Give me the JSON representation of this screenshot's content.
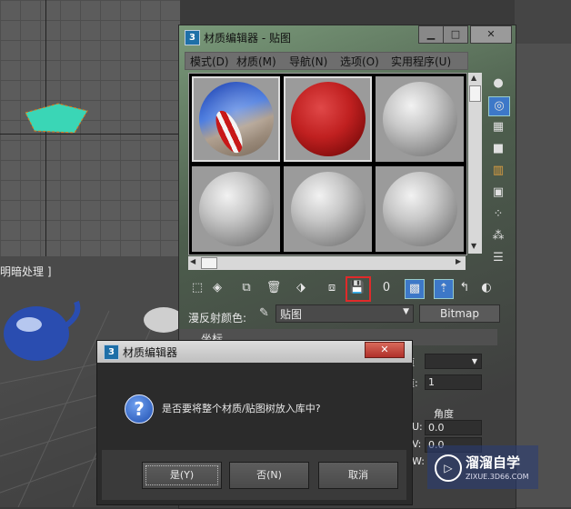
{
  "viewport": {
    "persp_label": "明暗处理 ]"
  },
  "material_editor": {
    "title": "材质编辑器 - 贴图",
    "app_icon": "3",
    "window_controls": [
      "minimize-icon",
      "maximize-icon",
      "close-icon"
    ],
    "close_glyph": "✕",
    "menu": [
      "模式(D)",
      "材质(M)",
      "导航(N)",
      "选项(O)",
      "实用程序(U)"
    ],
    "slots": [
      {
        "kind": "beach-ball",
        "active": true
      },
      {
        "kind": "red",
        "active": true
      },
      {
        "kind": "grey",
        "active": false
      },
      {
        "kind": "grey",
        "active": false
      },
      {
        "kind": "grey",
        "active": false
      },
      {
        "kind": "grey",
        "active": false
      }
    ],
    "side_tools": [
      "sample-type-icon",
      "backlight-icon",
      "background-icon",
      "sample-uv-icon",
      "video-color-icon",
      "make-preview-icon",
      "options-icon",
      "select-by-material-icon",
      "material-navigator-icon"
    ],
    "bottom_tools": [
      "get-material-icon",
      "put-to-scene-icon",
      "assign-to-selection-icon",
      "reset-map-icon",
      "make-copy-icon",
      "make-unique-icon",
      "put-to-library-icon",
      "material-id-icon",
      "show-in-viewport-icon",
      "show-end-result-icon",
      "go-to-parent-icon",
      "go-forward-icon"
    ],
    "highlighted_tool": "put-to-library-icon",
    "diffuse_label": "漫反射颜色:",
    "map_name": "贴图",
    "map_type_button": "Bitmap",
    "coord_rollout_title": "坐标",
    "params": {
      "channel_fragment": "道",
      "map_channel_label": "道:",
      "map_channel_value": "1",
      "angle_header": "角度",
      "u_label": "U:",
      "u_value": "0.0",
      "v_label": "V:",
      "v_value": "0.0",
      "w_label": "W:"
    }
  },
  "dialog": {
    "title": "材质编辑器",
    "app_icon": "3",
    "close_glyph": "✕",
    "question_glyph": "?",
    "message": "是否要将整个材质/贴图树放入库中?",
    "buttons": {
      "yes": "是(Y)",
      "no": "否(N)",
      "cancel": "取消"
    }
  },
  "watermark": {
    "name": "溜溜自学",
    "url": "ZIXUE.3D66.COM"
  },
  "colors": {
    "highlight": "#e02a2a",
    "dialog_bg": "#2b2b2b",
    "active_tool_blue": "#3d78c8"
  }
}
